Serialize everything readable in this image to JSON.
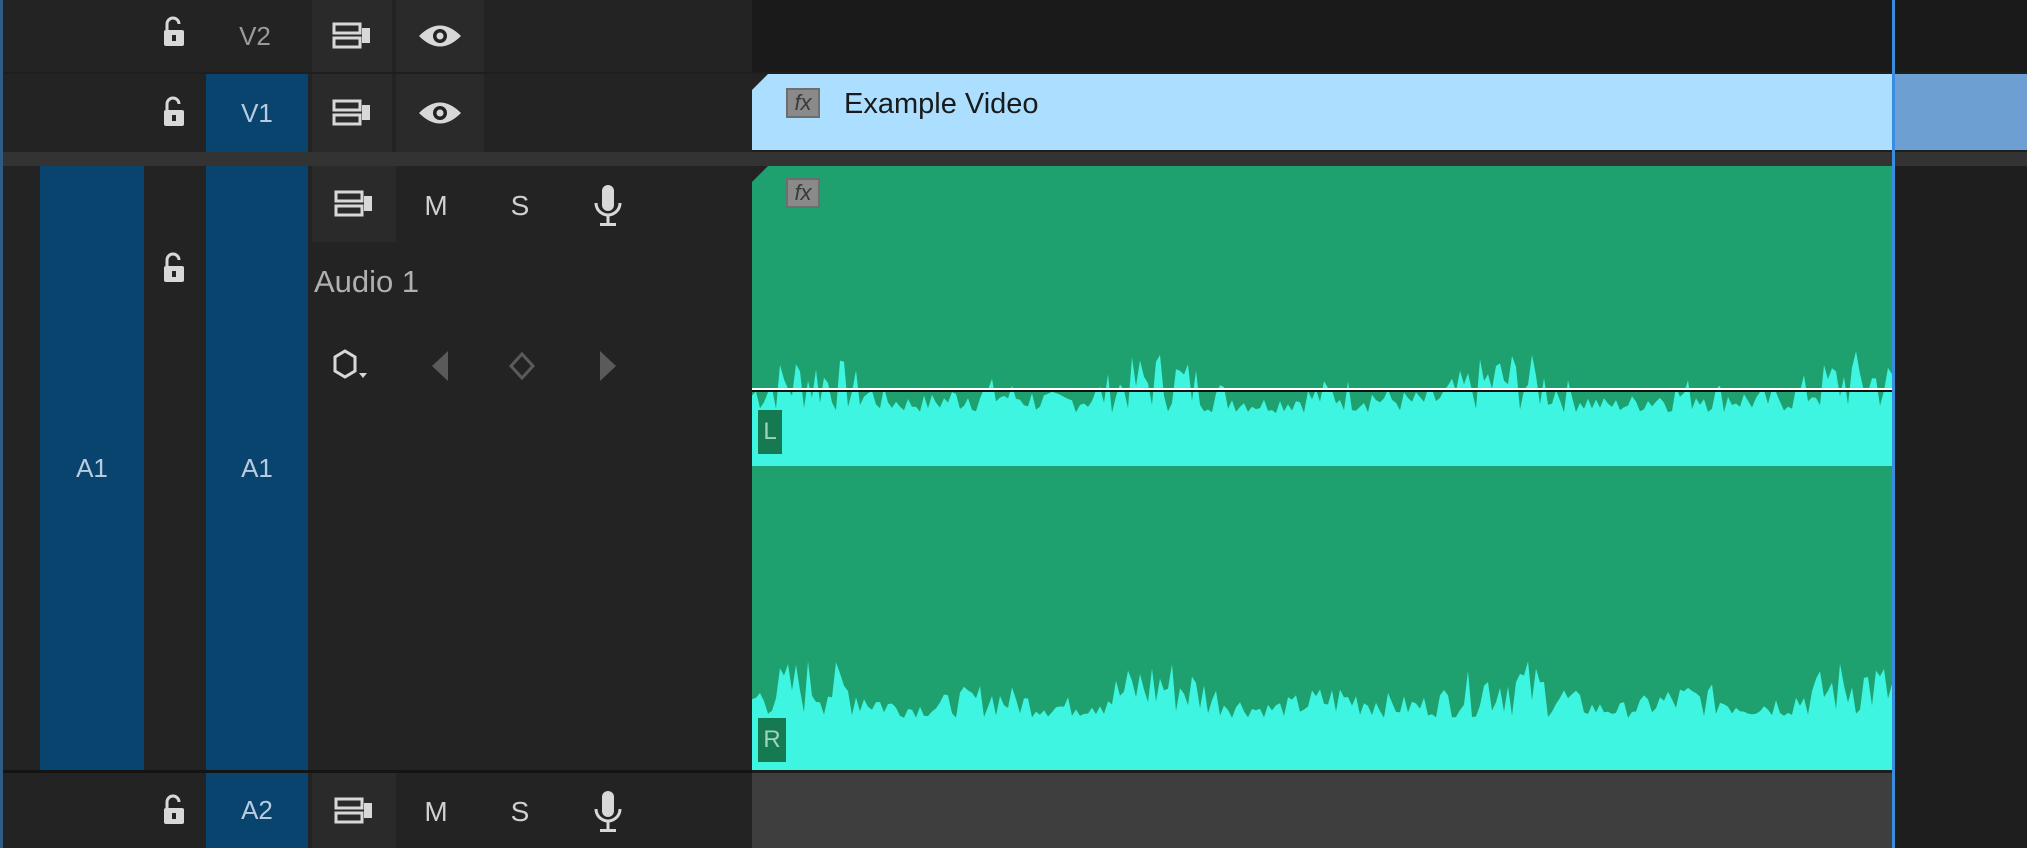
{
  "tracks": {
    "v2": {
      "label": "V2"
    },
    "v1": {
      "label": "V1"
    },
    "a1": {
      "source_label": "A1",
      "target_label": "A1",
      "name": "Audio 1",
      "mute_label": "M",
      "solo_label": "S"
    },
    "a2": {
      "label": "A2",
      "mute_label": "M",
      "solo_label": "S"
    }
  },
  "clips": {
    "video": {
      "title": "Example Video",
      "fx_label": "fx"
    },
    "audio": {
      "fx_label": "fx",
      "channel_left": "L",
      "channel_right": "R"
    }
  },
  "icons": [
    "lock-open-icon",
    "sync-lock-icon",
    "eye-icon",
    "microphone-icon",
    "keyframe-icon",
    "prev-keyframe-icon",
    "add-keyframe-icon",
    "next-keyframe-icon"
  ],
  "colors": {
    "track_target_blue": "#08446e",
    "video_clip": "#acdfff",
    "audio_clip": "#1fa06f",
    "waveform": "#3df5e0",
    "playhead": "#3a8dde"
  }
}
